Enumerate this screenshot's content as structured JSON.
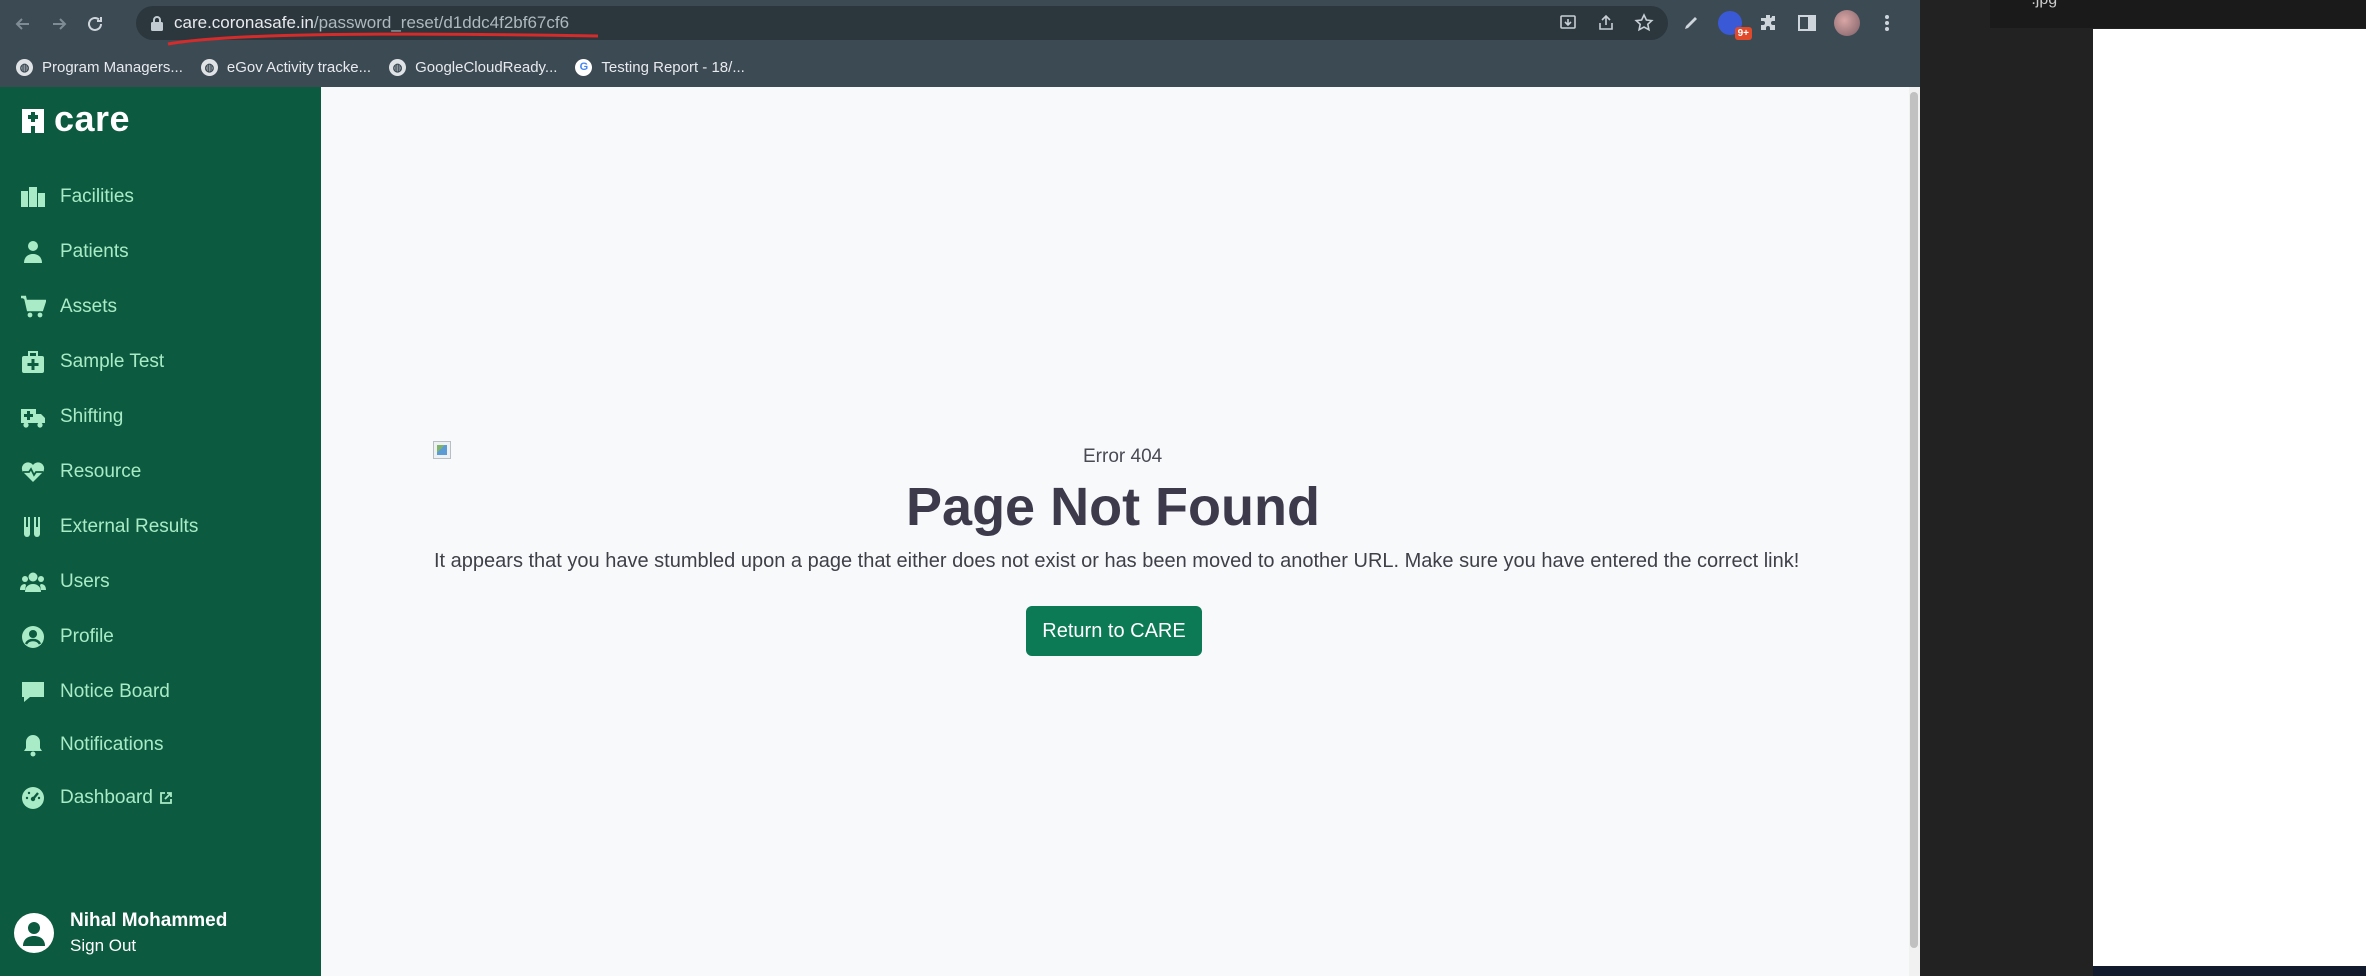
{
  "browser": {
    "url_domain": "care.coronasafe.in",
    "url_path": "/password_reset/d1ddc4f2bf67cf6",
    "extension_badge": "9+",
    "bookmarks": [
      {
        "label": "Program Managers...",
        "icon": "globe-icon"
      },
      {
        "label": "eGov Activity tracke...",
        "icon": "globe-icon"
      },
      {
        "label": "GoogleCloudReady...",
        "icon": "globe-icon"
      },
      {
        "label": "Testing Report - 18/...",
        "icon": "google-icon"
      }
    ]
  },
  "sidebar": {
    "logo_text": "care",
    "items": [
      {
        "label": "Facilities",
        "icon": "facilities-icon"
      },
      {
        "label": "Patients",
        "icon": "patient-icon"
      },
      {
        "label": "Assets",
        "icon": "cart-icon"
      },
      {
        "label": "Sample Test",
        "icon": "medkit-icon"
      },
      {
        "label": "Shifting",
        "icon": "ambulance-icon"
      },
      {
        "label": "Resource",
        "icon": "heartbeat-icon"
      },
      {
        "label": "External Results",
        "icon": "test-tubes-icon"
      },
      {
        "label": "Users",
        "icon": "users-icon"
      },
      {
        "label": "Profile",
        "icon": "user-circle-icon"
      },
      {
        "label": "Notice Board",
        "icon": "comment-icon"
      },
      {
        "label": "Notifications",
        "icon": "bell-icon"
      },
      {
        "label": "Dashboard",
        "icon": "dashboard-icon"
      }
    ],
    "user_name": "Nihal Mohammed",
    "sign_out_label": "Sign Out"
  },
  "main": {
    "error_code": "Error 404",
    "error_title": "Page Not Found",
    "error_description": "It appears that you have stumbled upon a page that either does not exist or has been moved to another URL. Make sure you have entered the correct link!",
    "return_button_label": "Return to CARE"
  },
  "right_window": {
    "label": "~.jpg"
  },
  "colors": {
    "sidebar_bg": "#0c5a3f",
    "sidebar_text": "#a8ebc6",
    "primary_button": "#0b7a55",
    "title_text": "#3d3a4b"
  }
}
